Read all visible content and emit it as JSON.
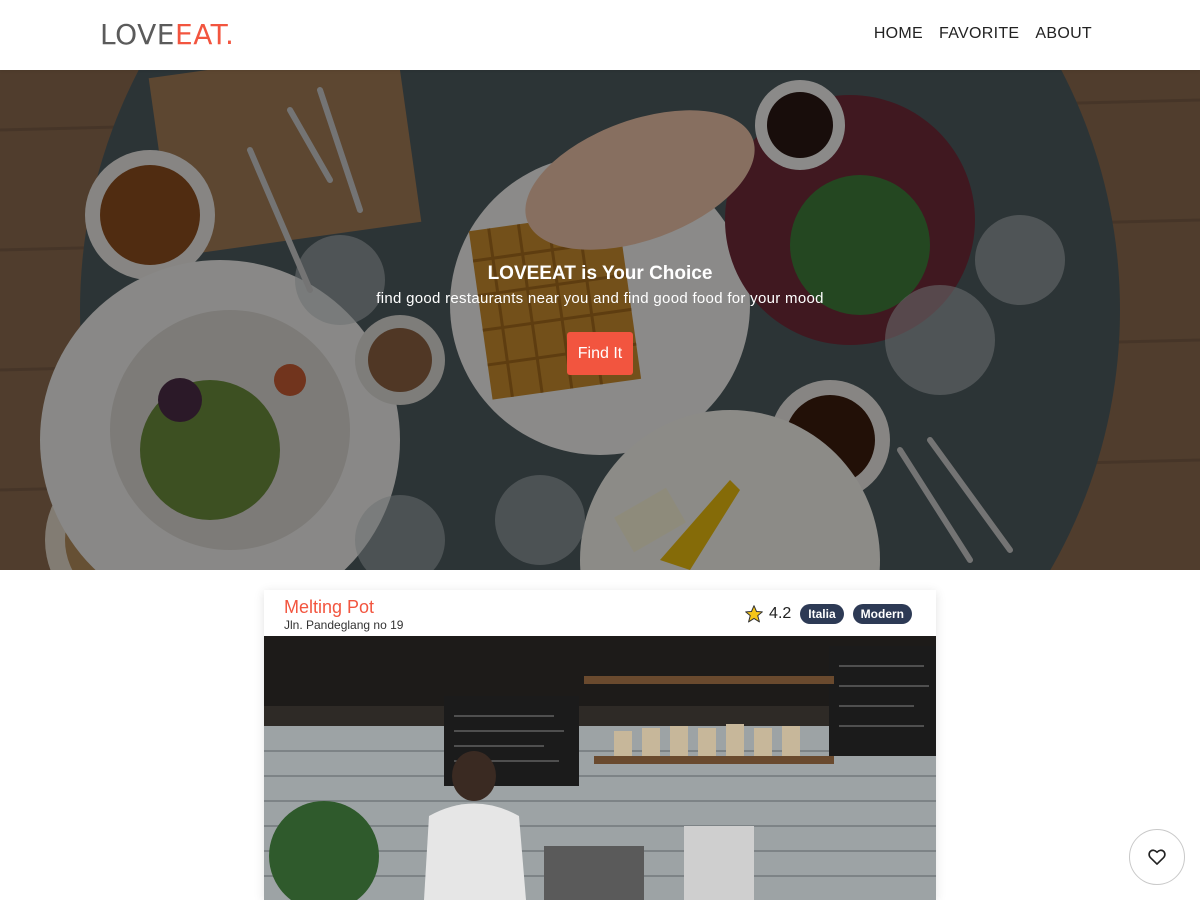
{
  "brand": {
    "part1": "LOVE",
    "part2": "EAT."
  },
  "nav": {
    "home": "HOME",
    "favorite": "FAVORITE",
    "about": "ABOUT"
  },
  "hero": {
    "title": "LOVEEAT is Your Choice",
    "subtitle": "find good restaurants near you and find good food for your mood",
    "cta": "Find It"
  },
  "restaurant": {
    "name": "Melting Pot",
    "address": "Jln. Pandeglang no 19",
    "rating": "4.2",
    "tags": [
      "Italia",
      "Modern"
    ]
  },
  "icons": {
    "star": "star-icon",
    "favorite": "heart-icon"
  },
  "colors": {
    "accent": "#f2553f",
    "tag_bg": "#2d3a55"
  }
}
